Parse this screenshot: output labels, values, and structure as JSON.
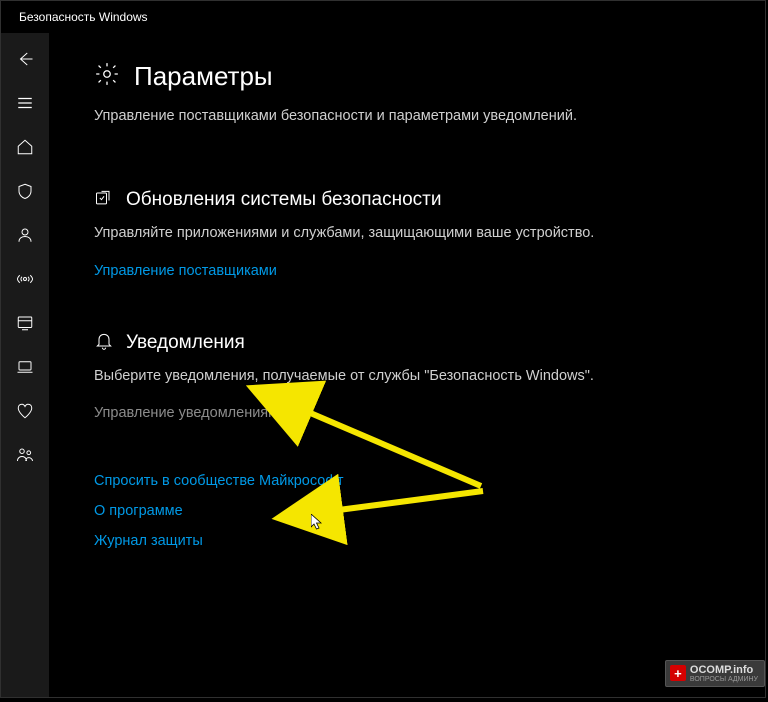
{
  "window": {
    "title": "Безопасность Windows"
  },
  "page": {
    "title": "Параметры",
    "subtitle": "Управление поставщиками безопасности и параметрами уведомлений."
  },
  "sections": {
    "updates": {
      "title": "Обновления системы безопасности",
      "desc": "Управляйте приложениями и службами, защищающими ваше устройство.",
      "link": "Управление поставщиками"
    },
    "notifications": {
      "title": "Уведомления",
      "desc": "Выберите уведомления, получаемые от службы \"Безопасность Windows\".",
      "link": "Управление уведомлениями"
    }
  },
  "footer": {
    "community": "Спросить в сообществе Майкрософт",
    "about": "О программе",
    "history": "Журнал защиты"
  },
  "watermark": {
    "main": "OCOMP.info",
    "sub": "ВОПРОСЫ АДМИНУ"
  }
}
